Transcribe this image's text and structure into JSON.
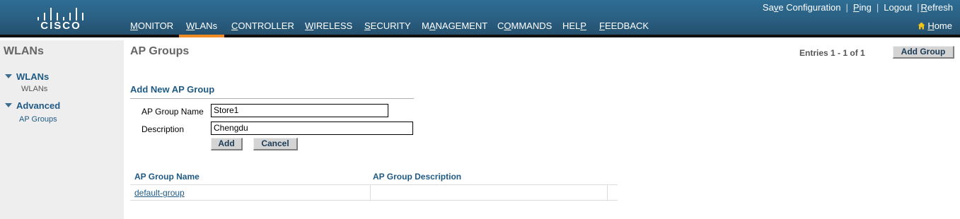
{
  "header": {
    "logo_text": "CISCO",
    "nav": [
      {
        "label": "MONITOR",
        "u": "M",
        "rest": "ONITOR"
      },
      {
        "label": "WLANs",
        "u": "W",
        "rest": "LANs"
      },
      {
        "label": "CONTROLLER",
        "u": "C",
        "rest": "ONTROLLER"
      },
      {
        "label": "WIRELESS",
        "u": "W",
        "rest": "IRELESS"
      },
      {
        "label": "SECURITY",
        "u": "S",
        "rest": "ECURITY"
      },
      {
        "label": "MANAGEMENT",
        "pre": "M",
        "u": "A",
        "rest": "NAGEMENT"
      },
      {
        "label": "COMMANDS",
        "pre": "C",
        "u": "O",
        "rest": "MMANDS"
      },
      {
        "label": "HELP",
        "pre": "HEL",
        "u": "P",
        "rest": ""
      },
      {
        "label": "FEEDBACK",
        "u": "F",
        "rest": "EEDBACK"
      }
    ],
    "active_nav": "WLANs",
    "links": {
      "save_pre": "Sa",
      "save_u": "v",
      "save_rest": "e Configuration",
      "ping_u": "P",
      "ping_rest": "ing",
      "logout_pre": "Lo",
      "logout_u": "g",
      "logout_rest": "out",
      "refresh_u": "R",
      "refresh_rest": "efresh"
    },
    "home_u": "H",
    "home_rest": "ome"
  },
  "sidebar": {
    "title": "WLANs",
    "sections": [
      {
        "label": "WLANs",
        "items": [
          "WLANs"
        ]
      },
      {
        "label": "Advanced",
        "items": [
          "AP Groups"
        ]
      }
    ]
  },
  "main": {
    "title": "AP Groups",
    "entries": "Entries 1 - 1 of 1",
    "add_group_button": "Add Group",
    "form": {
      "title": "Add New AP Group",
      "name_label": "AP Group Name",
      "name_value": "Store1",
      "desc_label": "Description",
      "desc_value": "Chengdu",
      "add_button": "Add",
      "cancel_button": "Cancel"
    },
    "table": {
      "columns": [
        "AP Group Name",
        "AP Group Description"
      ],
      "rows": [
        {
          "name": "default-group",
          "description": ""
        }
      ]
    }
  },
  "colors": {
    "header_bg": "#2a5f82",
    "active_tab": "#f08a24",
    "section_blue": "#1e5a84",
    "sidebar_bg": "#eeeeee"
  },
  "icons": [
    "home-icon",
    "expand-triangle-icon"
  ]
}
